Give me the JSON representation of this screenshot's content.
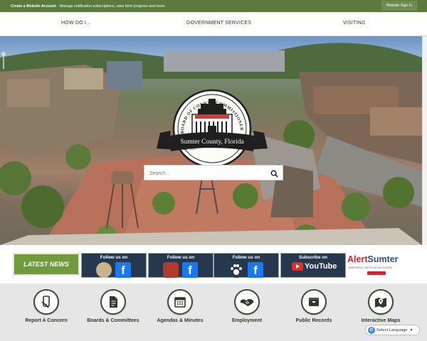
{
  "topbar": {
    "create_account_label": "Create a Website Account",
    "create_account_text": "- Manage notification subscriptions, save form progress and more.",
    "signin_label": "Website Sign In"
  },
  "nav": {
    "items": [
      {
        "label": "HOW DO I..."
      },
      {
        "label": "GOVERNMENT SERVICES"
      },
      {
        "label": "VISITING"
      }
    ]
  },
  "seal": {
    "arc_text": "BOARD OF COUNTY COMMISSIONERS",
    "ribbon_text": "Sumter County, Florida",
    "est_text": "Est. 1853"
  },
  "search": {
    "placeholder": "Search..."
  },
  "banners": {
    "latest_news": "LATEST NEWS",
    "follow": [
      {
        "label": "Follow us on",
        "icon": "sheriff-badge-icon"
      },
      {
        "label": "Follow us on",
        "icon": "fire-rescue-patch-icon"
      },
      {
        "label": "Follow us on",
        "icon": "paw-print-icon"
      }
    ],
    "facebook_glyph": "f",
    "youtube": {
      "label": "Subscribe on",
      "word": "YouTube"
    },
    "alert": {
      "word_red": "Alert",
      "word_blue": "Sumter",
      "tagline": "EMERGENCY NOTIFICATION SYSTEM"
    }
  },
  "quick_links": [
    {
      "label": "Report A Concern",
      "icon": "phone-hand-icon"
    },
    {
      "label": "Boards & Committees",
      "icon": "document-icon"
    },
    {
      "label": "Agendas & Minutes",
      "icon": "calendar-icon"
    },
    {
      "label": "Employment",
      "icon": "handshake-icon"
    },
    {
      "label": "Public Records",
      "icon": "file-box-icon"
    },
    {
      "label": "Interactive Maps",
      "icon": "map-pin-icon"
    }
  ],
  "translate": {
    "label": "Select Language",
    "g_glyph": "G"
  },
  "colors": {
    "topbar": "#5a7a3e",
    "latest_news": "#6f9b3d",
    "banner_bg": "#25384d",
    "facebook": "#1877f2",
    "youtube": "#e52d27",
    "alert_red": "#d1232a",
    "alert_blue": "#2d4f8a",
    "quicklinks_bg": "#e6e6e6"
  }
}
